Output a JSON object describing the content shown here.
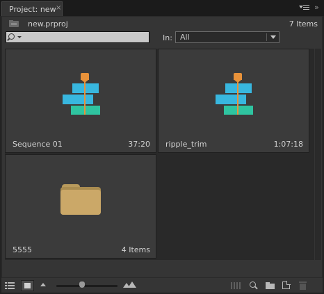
{
  "tab": {
    "title": "Project: new",
    "close": "×"
  },
  "header": {
    "project_file": "new.prproj",
    "item_count": "7 Items"
  },
  "search": {
    "value": "",
    "placeholder": ""
  },
  "in_filter": {
    "label": "In:",
    "selected": "All"
  },
  "items": [
    {
      "name": "Sequence 01",
      "meta": "37:20",
      "kind": "sequence"
    },
    {
      "name": "ripple_trim",
      "meta": "1:07:18",
      "kind": "sequence"
    },
    {
      "name": "5555",
      "meta": "4 Items",
      "kind": "bin"
    }
  ],
  "colors": {
    "panel_bg": "#353535",
    "tile_bg": "#3b3b3b",
    "sequence_clip_blue": "#38b7df",
    "sequence_clip_green": "#2fc4a0",
    "playhead_orange": "#e8923a",
    "folder_tan": "#cba868"
  },
  "toolbar": {
    "icons": [
      "list-view-icon",
      "icon-view-icon",
      "zoom-out-icon",
      "zoom-slider",
      "zoom-in-icon",
      "automate-to-sequence-icon",
      "find-icon",
      "new-bin-icon",
      "new-item-icon",
      "trash-icon"
    ],
    "zoom_level": 0.42
  }
}
